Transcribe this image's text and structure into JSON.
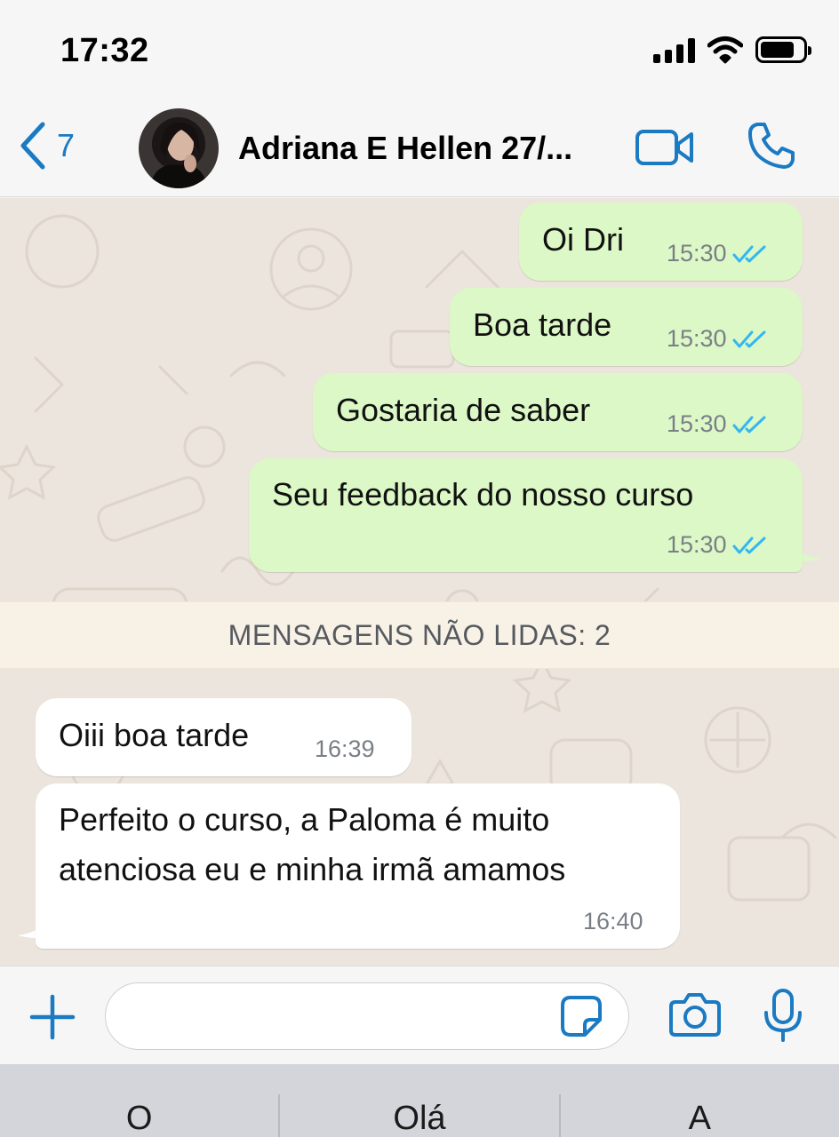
{
  "status_bar": {
    "time": "17:32"
  },
  "header": {
    "back_count": "7",
    "contact_name": "Adriana E Hellen 27/..."
  },
  "messages_outgoing": [
    {
      "text": "Oi Dri",
      "time": "15:30"
    },
    {
      "text": "Boa tarde",
      "time": "15:30"
    },
    {
      "text": "Gostaria de saber",
      "time": "15:30"
    },
    {
      "text": "Seu feedback do nosso curso",
      "time": "15:30"
    }
  ],
  "unread_banner": "MENSAGENS NÃO LIDAS: 2",
  "messages_incoming": [
    {
      "text": "Oiii boa tarde",
      "time": "16:39"
    },
    {
      "line1": "Perfeito o curso, a Paloma é muito",
      "line2": "atenciosa eu e minha irmã amamos",
      "time": "16:40"
    }
  ],
  "input": {
    "value": "",
    "placeholder": ""
  },
  "keyboard_suggestions": [
    "O",
    "Olá",
    "A"
  ],
  "colors": {
    "ios_blue": "#1a7ac2",
    "outgoing_bubble": "#dcf8c6",
    "incoming_bubble": "#ffffff",
    "read_receipt": "#34b7f1",
    "chat_background": "#ece5dd"
  },
  "icons": {
    "back": "chevron-left-icon",
    "video": "video-camera-icon",
    "call": "phone-icon",
    "read_receipt": "double-check-icon",
    "add": "plus-icon",
    "sticker": "sticker-icon",
    "camera": "camera-icon",
    "mic": "microphone-icon"
  }
}
